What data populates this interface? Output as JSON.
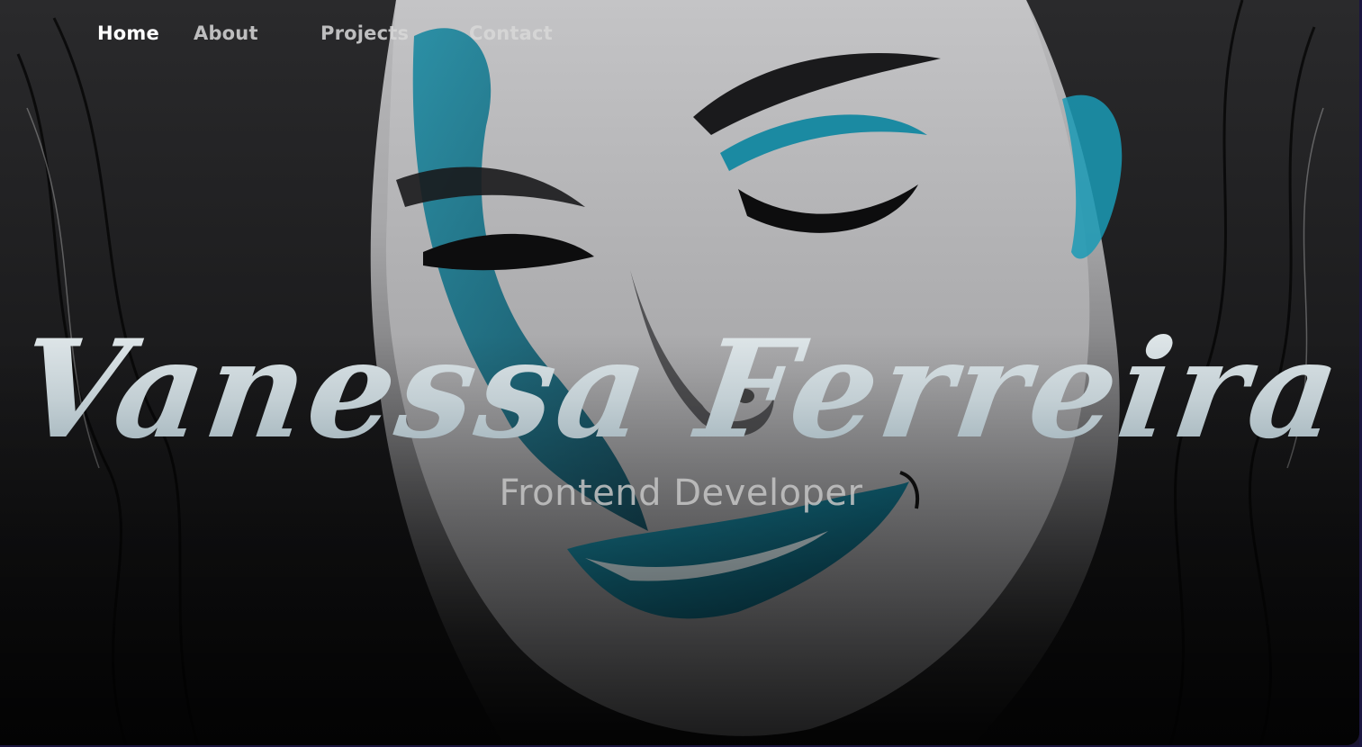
{
  "nav": {
    "items": [
      {
        "label": "Home",
        "active": true
      },
      {
        "label": "About",
        "active": false
      },
      {
        "label": "Projects",
        "active": false
      },
      {
        "label": "Contact",
        "active": false
      }
    ]
  },
  "hero": {
    "title": "Vanessa Ferreira",
    "subtitle": "Frontend Developer",
    "background_image": "portrait-illustration",
    "colors": {
      "accent_teal": "#0e6f86",
      "text_light": "#c7d3d8",
      "nav_active": "#ffffff",
      "nav_inactive": "#d9d9d9"
    }
  }
}
